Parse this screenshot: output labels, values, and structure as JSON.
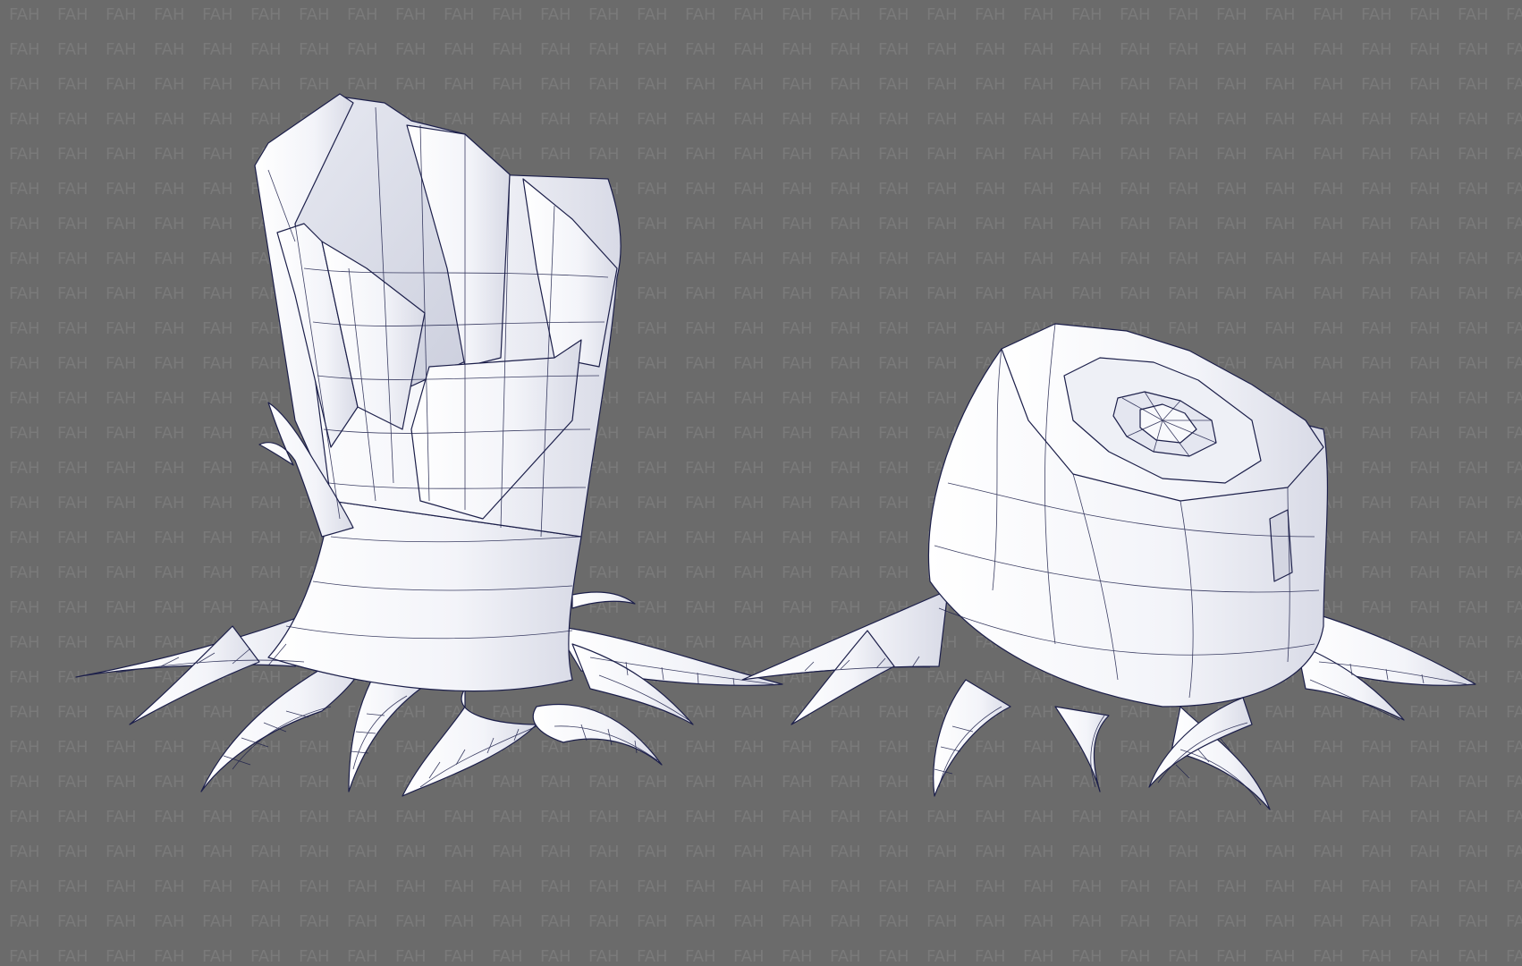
{
  "watermark": {
    "text": "FAH",
    "color": "#7a7a7a"
  },
  "colors": {
    "background": "#6b6b6b",
    "mesh_fill": "#f6f7fb",
    "mesh_shade": "#d9dbe6",
    "wire": "#1c1f4a"
  },
  "models": [
    {
      "name": "broken-tree-stump"
    },
    {
      "name": "cut-tree-stump"
    }
  ]
}
